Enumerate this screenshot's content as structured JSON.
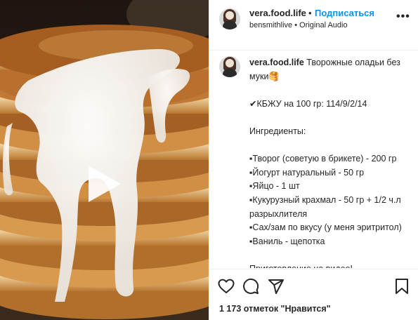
{
  "header": {
    "username": "vera.food.life",
    "separator": "•",
    "follow_label": "Подписаться",
    "subtitle": "bensmithlive • Original Audio",
    "more_label": "•••"
  },
  "caption": {
    "username": "vera.food.life",
    "text": " Творожные оладьи без муки🥞\n\n✔КБЖУ на 100 гр: 114/9/2/14\n\nИнгредиенты:\n\n▪Творог (советую в брикете) - 200 гр\n▪Йогурт натуральный - 50 гр\n▪Яйцо - 1 шт\n▪Кукурузный крахмал - 50 гр + 1/2 ч.л разрыхлителя\n▪Сах/зам по вкусу (у меня эритритол)\n▪Ваниль - щепотка\n\nПриготовление на видео!\n\nВнутрь можно добавить любую начинку, а подавать со сгущёнкой (у"
  },
  "actions": {
    "likes_text": "1 173 отметок \"Нравится\""
  },
  "icons": {
    "play": "play-icon",
    "like": "heart-icon",
    "comment": "comment-icon",
    "share": "send-icon",
    "save": "bookmark-icon",
    "more": "more-icon"
  },
  "colors": {
    "follow": "#0095f6",
    "text": "#262626",
    "divider": "#efefef"
  }
}
